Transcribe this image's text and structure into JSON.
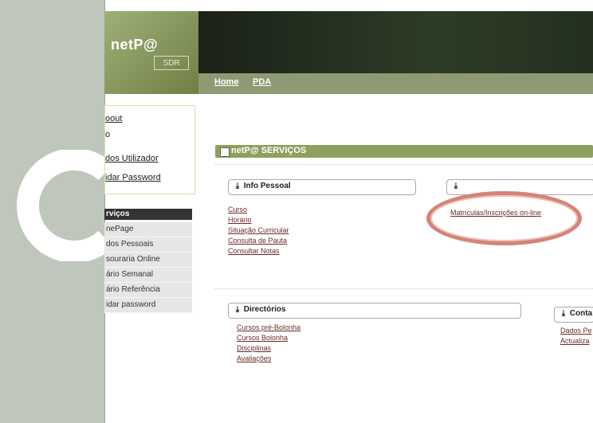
{
  "header": {
    "logo_text": "netP@",
    "logo_box_text": "SDR",
    "nav": {
      "home": "Home",
      "pda": "PDA"
    }
  },
  "left_menu": {
    "items": [
      "oout",
      "o",
      "dos Utilizador",
      "idar Password"
    ]
  },
  "services": {
    "title": "rviços",
    "items": [
      "nePage",
      "dos Pessoais",
      "souraria Online",
      "ário Semanal",
      "ário Referência",
      "idar password"
    ]
  },
  "main": {
    "section_title": "netP@ SERVIÇOS",
    "info_pessoal": {
      "title": "Info Pessoal",
      "links": [
        "Curso",
        "Horário",
        "Situação Curricular",
        "Consulta de Pauta",
        "Consultar Notas"
      ]
    },
    "matriculas": {
      "title": "",
      "link": "Matrículas/Inscrições on-line"
    },
    "diretorios": {
      "title": "Directórios",
      "links": [
        "Cursos pré-Bolonha",
        "Cursos Bolonha",
        "Disciplinas",
        "Avaliações"
      ]
    },
    "contactos": {
      "title": "Conta",
      "links": [
        "Dados Pe",
        "Actualiza"
      ]
    }
  },
  "icons": {
    "download": "download-arrow-icon",
    "logo": "netpa-logo"
  }
}
